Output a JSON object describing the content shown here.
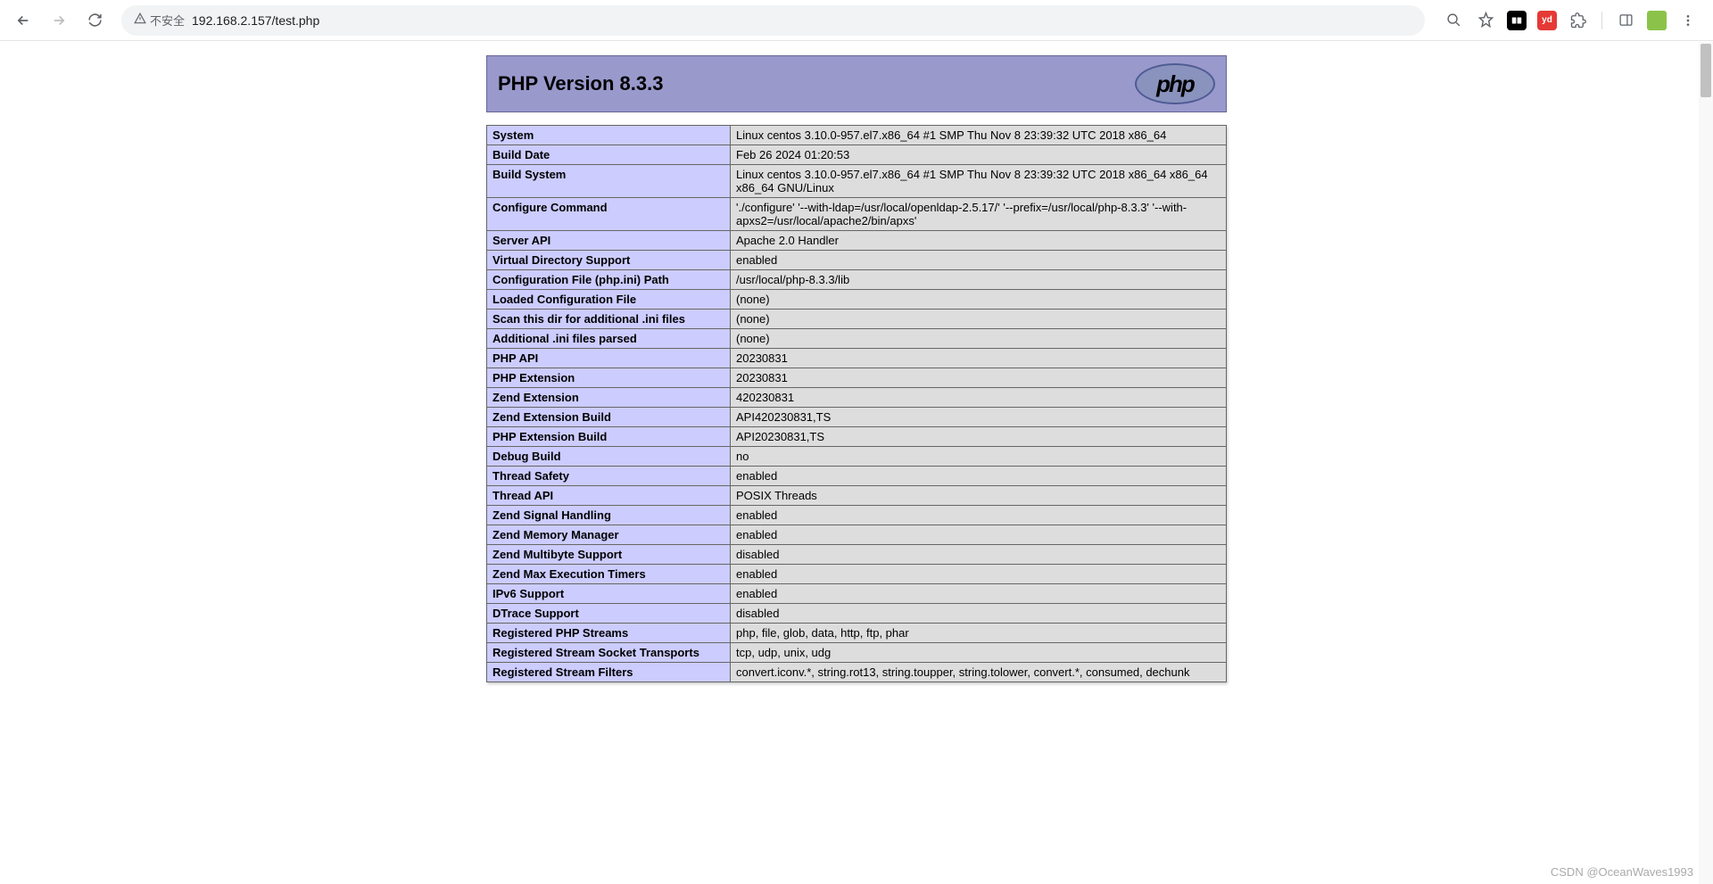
{
  "browser": {
    "security_label": "不安全",
    "url": "192.168.2.157/test.php"
  },
  "header": {
    "title": "PHP Version 8.3.3",
    "logo_text": "php"
  },
  "rows": [
    {
      "label": "System",
      "value": "Linux centos 3.10.0-957.el7.x86_64 #1 SMP Thu Nov 8 23:39:32 UTC 2018 x86_64"
    },
    {
      "label": "Build Date",
      "value": "Feb 26 2024 01:20:53"
    },
    {
      "label": "Build System",
      "value": "Linux centos 3.10.0-957.el7.x86_64 #1 SMP Thu Nov 8 23:39:32 UTC 2018 x86_64 x86_64 x86_64 GNU/Linux"
    },
    {
      "label": "Configure Command",
      "value": "'./configure' '--with-ldap=/usr/local/openldap-2.5.17/' '--prefix=/usr/local/php-8.3.3' '--with-apxs2=/usr/local/apache2/bin/apxs'"
    },
    {
      "label": "Server API",
      "value": "Apache 2.0 Handler"
    },
    {
      "label": "Virtual Directory Support",
      "value": "enabled"
    },
    {
      "label": "Configuration File (php.ini) Path",
      "value": "/usr/local/php-8.3.3/lib"
    },
    {
      "label": "Loaded Configuration File",
      "value": "(none)"
    },
    {
      "label": "Scan this dir for additional .ini files",
      "value": "(none)"
    },
    {
      "label": "Additional .ini files parsed",
      "value": "(none)"
    },
    {
      "label": "PHP API",
      "value": "20230831"
    },
    {
      "label": "PHP Extension",
      "value": "20230831"
    },
    {
      "label": "Zend Extension",
      "value": "420230831"
    },
    {
      "label": "Zend Extension Build",
      "value": "API420230831,TS"
    },
    {
      "label": "PHP Extension Build",
      "value": "API20230831,TS"
    },
    {
      "label": "Debug Build",
      "value": "no"
    },
    {
      "label": "Thread Safety",
      "value": "enabled"
    },
    {
      "label": "Thread API",
      "value": "POSIX Threads"
    },
    {
      "label": "Zend Signal Handling",
      "value": "enabled"
    },
    {
      "label": "Zend Memory Manager",
      "value": "enabled"
    },
    {
      "label": "Zend Multibyte Support",
      "value": "disabled"
    },
    {
      "label": "Zend Max Execution Timers",
      "value": "enabled"
    },
    {
      "label": "IPv6 Support",
      "value": "enabled"
    },
    {
      "label": "DTrace Support",
      "value": "disabled"
    },
    {
      "label": "Registered PHP Streams",
      "value": "php, file, glob, data, http, ftp, phar"
    },
    {
      "label": "Registered Stream Socket Transports",
      "value": "tcp, udp, unix, udg"
    },
    {
      "label": "Registered Stream Filters",
      "value": "convert.iconv.*, string.rot13, string.toupper, string.tolower, convert.*, consumed, dechunk"
    }
  ],
  "watermark": "CSDN @OceanWaves1993"
}
